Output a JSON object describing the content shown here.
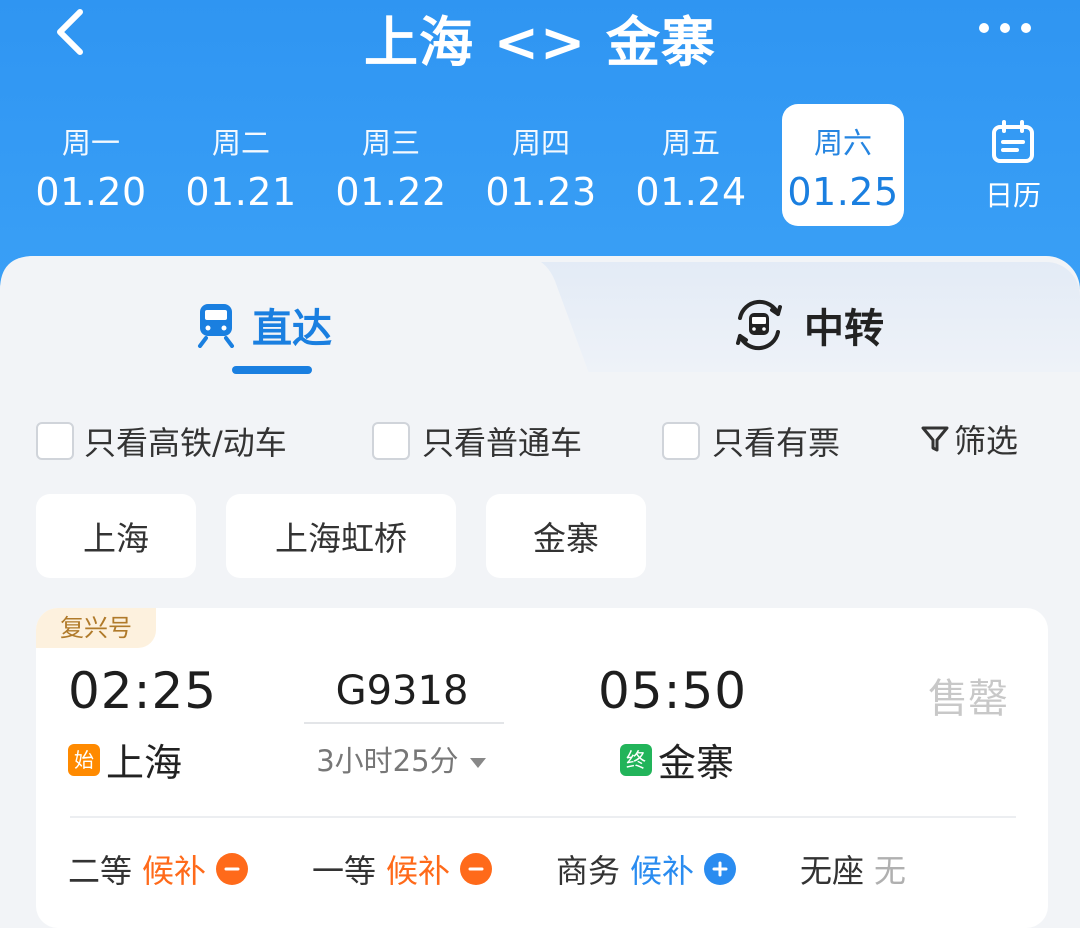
{
  "header": {
    "title": "上海 <> 金寨",
    "dates": [
      {
        "weekday": "周一",
        "date": "01.20"
      },
      {
        "weekday": "周二",
        "date": "01.21"
      },
      {
        "weekday": "周三",
        "date": "01.22"
      },
      {
        "weekday": "周四",
        "date": "01.23"
      },
      {
        "weekday": "周五",
        "date": "01.24"
      },
      {
        "weekday": "周六",
        "date": "01.25",
        "selected": true
      }
    ],
    "calendar_label": "日历"
  },
  "tabs": {
    "direct": "直达",
    "transfer": "中转",
    "active": "direct"
  },
  "filters": {
    "high_speed": "只看高铁/动车",
    "regular": "只看普通车",
    "available": "只看有票",
    "filter_button": "筛选"
  },
  "stations": [
    "上海",
    "上海虹桥",
    "金寨"
  ],
  "train": {
    "brand": "复兴号",
    "depart_time": "02:25",
    "depart_badge": "始",
    "depart_station": "上海",
    "train_no": "G9318",
    "duration": "3小时25分",
    "arrive_time": "05:50",
    "arrive_badge": "终",
    "arrive_station": "金寨",
    "status": "售罄",
    "seats": [
      {
        "class": "二等",
        "status": "候补",
        "action": "minus"
      },
      {
        "class": "一等",
        "status": "候补",
        "action": "minus"
      },
      {
        "class": "商务",
        "status": "候补",
        "action": "plus"
      },
      {
        "class": "无座",
        "status": "无"
      }
    ]
  },
  "colors": {
    "header_blue": "#2f95f2",
    "accent_blue": "#1a7fe0",
    "waitlist_orange": "#ff6a1a",
    "start_badge": "#ff8a00",
    "end_badge": "#22b45a"
  }
}
